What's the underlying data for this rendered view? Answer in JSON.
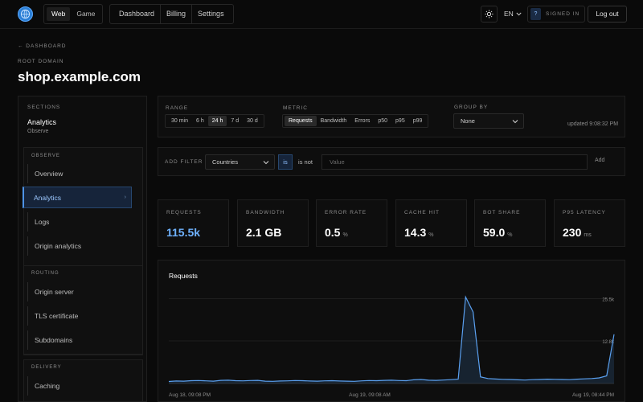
{
  "header": {
    "segment": [
      {
        "label": "Web",
        "active": true
      },
      {
        "label": "Game",
        "active": false
      }
    ],
    "nav": [
      "Dashboard",
      "Billing",
      "Settings"
    ],
    "theme_icon": "sun-icon",
    "language": "EN",
    "signed_badge": "?",
    "signed_label": "SIGNED IN",
    "logout": "Log out"
  },
  "page": {
    "back": "← DASHBOARD",
    "root_label": "ROOT DOMAIN",
    "domain": "shop.example.com"
  },
  "sidebar": {
    "sections_label": "SECTIONS",
    "title": "Analytics",
    "subtitle": "Observe",
    "groups": [
      {
        "label": "OBSERVE",
        "items": [
          "Overview",
          "Analytics",
          "Logs",
          "Origin analytics"
        ]
      },
      {
        "label": "ROUTING",
        "items": [
          "Origin server",
          "TLS certificate",
          "Subdomains"
        ]
      },
      {
        "label": "DELIVERY",
        "items": [
          "Caching"
        ]
      }
    ],
    "active_item": "Analytics"
  },
  "controls": {
    "range_label": "RANGE",
    "ranges": [
      "30 min",
      "6 h",
      "24 h",
      "7 d",
      "30 d"
    ],
    "active_range": "24 h",
    "metric_label": "METRIC",
    "metrics": [
      "Requests",
      "Bandwidth",
      "Errors",
      "p50",
      "p95",
      "p99"
    ],
    "active_metric": "Requests",
    "groupby_label": "GROUP BY",
    "groupby_value": "None",
    "updated": "updated 9:08:32 PM"
  },
  "filter": {
    "label": "ADD FILTER",
    "field": "Countries",
    "op_is": "is",
    "op_isnot": "is not",
    "value_placeholder": "Value",
    "add": "Add"
  },
  "stats": [
    {
      "label": "REQUESTS",
      "value": "115.5k",
      "unit": ""
    },
    {
      "label": "BANDWIDTH",
      "value": "2.1 GB",
      "unit": ""
    },
    {
      "label": "ERROR RATE",
      "value": "0.5",
      "unit": "%"
    },
    {
      "label": "CACHE HIT",
      "value": "14.3",
      "unit": "%"
    },
    {
      "label": "BOT SHARE",
      "value": "59.0",
      "unit": "%"
    },
    {
      "label": "P95 LATENCY",
      "value": "230",
      "unit": "ms"
    }
  ],
  "colors": {
    "accent": "#4d93e6",
    "line": "#5aa0f0",
    "background": "#0a0a0a"
  },
  "chart_data": {
    "type": "area",
    "title": "Requests",
    "xlabel": "",
    "ylabel": "",
    "x_ticks": [
      "Aug 18, 09:08 PM",
      "Aug 19, 09:08 AM",
      "Aug 19, 08:44 PM"
    ],
    "y_ticks": [
      "25.5k",
      "12.8k"
    ],
    "ylim": [
      0,
      29000
    ],
    "grid": true,
    "series": [
      {
        "values": [
          600,
          750,
          700,
          850,
          900,
          800,
          700,
          950,
          1000,
          850,
          800,
          900,
          950,
          700,
          650,
          750,
          800,
          900,
          850,
          750,
          700,
          800,
          850,
          750,
          700,
          650,
          800,
          900,
          850,
          950,
          1000,
          900,
          850,
          1100,
          1200,
          1000,
          950,
          1050,
          1150,
          1300,
          26000,
          21500,
          2000,
          1500,
          1350,
          1250,
          1200,
          1100,
          1050,
          1150,
          1200,
          1300,
          1250,
          1200,
          1150,
          1300,
          1400,
          1500,
          1700,
          2300,
          14800
        ]
      }
    ]
  }
}
